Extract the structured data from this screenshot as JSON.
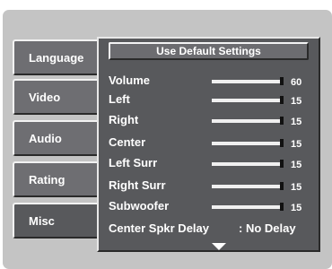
{
  "tabs": [
    {
      "label": "Language"
    },
    {
      "label": "Video"
    },
    {
      "label": "Audio"
    },
    {
      "label": "Rating"
    },
    {
      "label": "Misc"
    }
  ],
  "selected_tab": "Misc",
  "panel": {
    "default_button": "Use Default Settings",
    "sliders": [
      {
        "label": "Volume",
        "value": "60",
        "level": 1.0
      },
      {
        "label": "Left",
        "value": "15",
        "level": 1.0
      },
      {
        "label": "Right",
        "value": "15",
        "level": 1.0
      },
      {
        "label": "Center",
        "value": "15",
        "level": 1.0
      },
      {
        "label": "Left Surr",
        "value": "15",
        "level": 1.0
      },
      {
        "label": "Right Surr",
        "value": "15",
        "level": 1.0
      },
      {
        "label": "Subwoofer",
        "value": "15",
        "level": 1.0
      }
    ],
    "delay": {
      "label": "Center Spkr Delay",
      "value": ": No Delay"
    },
    "scroll_down_icon": "triangle-down-icon"
  }
}
